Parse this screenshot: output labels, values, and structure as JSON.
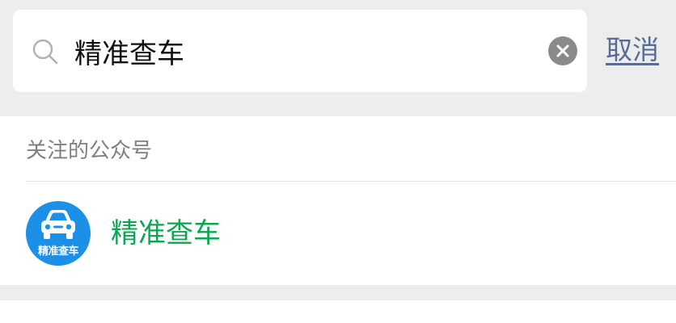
{
  "search": {
    "value": "精准查车",
    "icon": "search-icon",
    "clear_icon": "clear-icon",
    "cancel_label": "取消"
  },
  "colors": {
    "background": "#ededed",
    "link": "#576b95",
    "match_highlight": "#07a84e",
    "avatar_bg": "#1c8fe7"
  },
  "results": {
    "section_title": "关注的公众号",
    "accounts": [
      {
        "name": "精准查车",
        "avatar_text": "精准查车",
        "avatar_icon": "car-icon"
      }
    ]
  }
}
